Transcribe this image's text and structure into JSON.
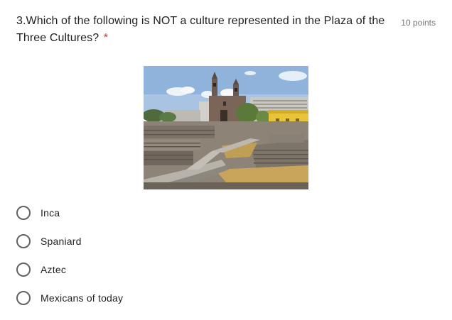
{
  "question": {
    "number_and_text": "3.Which of the following is NOT a culture represented in the Plaza of the Three Cultures?",
    "required_marker": "*",
    "points": "10 points"
  },
  "options": [
    {
      "label": "Inca"
    },
    {
      "label": "Spaniard"
    },
    {
      "label": "Aztec"
    },
    {
      "label": "Mexicans of today"
    }
  ],
  "colors": {
    "required": "#d93025",
    "text": "#202124",
    "muted": "#70757a",
    "radio_border": "#5f6368"
  }
}
